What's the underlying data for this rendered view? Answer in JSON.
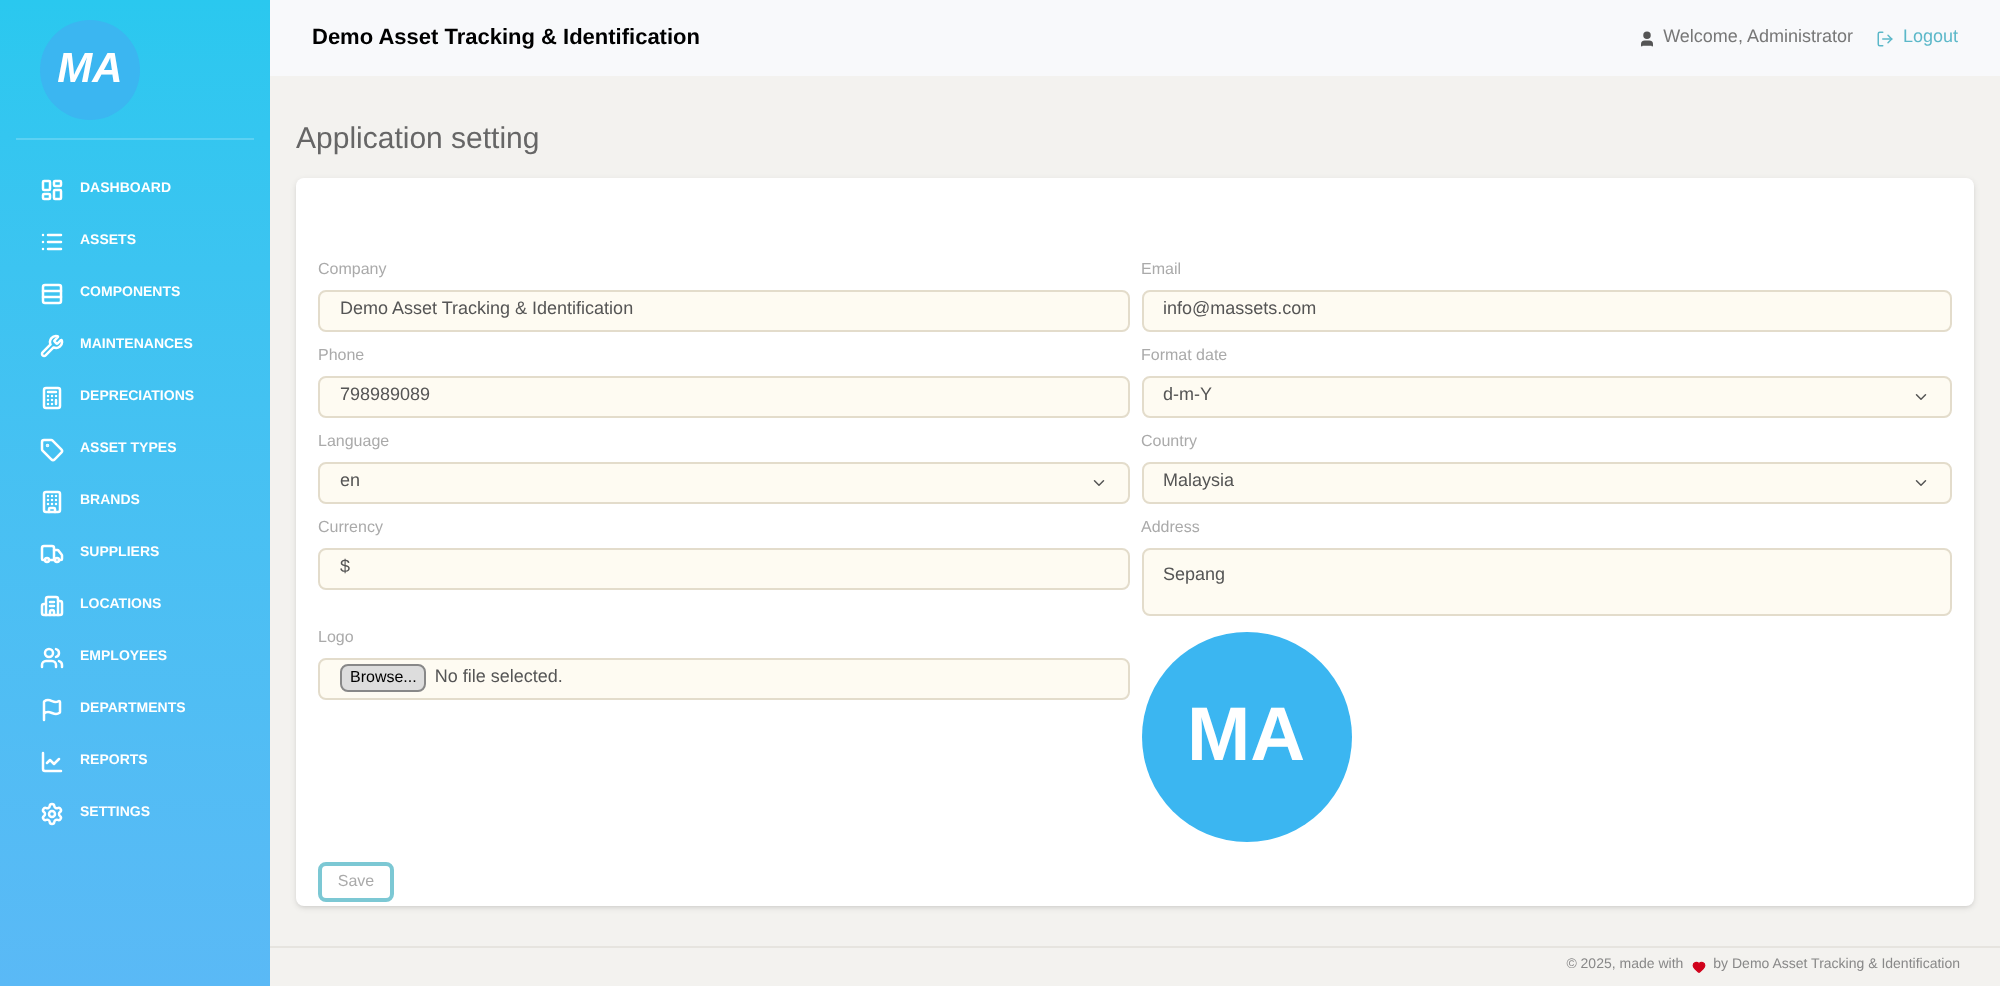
{
  "sidebar": {
    "logo": "MA",
    "items": [
      {
        "label": "DASHBOARD"
      },
      {
        "label": "ASSETS"
      },
      {
        "label": "COMPONENTS"
      },
      {
        "label": "MAINTENANCES"
      },
      {
        "label": "DEPRECIATIONS"
      },
      {
        "label": "ASSET TYPES"
      },
      {
        "label": "BRANDS"
      },
      {
        "label": "SUPPLIERS"
      },
      {
        "label": "LOCATIONS"
      },
      {
        "label": "EMPLOYEES"
      },
      {
        "label": "DEPARTMENTS"
      },
      {
        "label": "REPORTS"
      },
      {
        "label": "SETTINGS"
      }
    ]
  },
  "header": {
    "title": "Demo Asset Tracking & Identification",
    "welcome": "Welcome, Administrator",
    "logout": "Logout"
  },
  "page": {
    "title": "Application setting"
  },
  "form": {
    "left": [
      {
        "label": "Company",
        "kind": "text",
        "value": "Demo Asset Tracking & Identification"
      },
      {
        "label": "Phone",
        "kind": "text",
        "value": "798989089"
      },
      {
        "label": "Language",
        "kind": "select",
        "value": "en"
      },
      {
        "label": "Currency",
        "kind": "text",
        "value": "$"
      },
      {
        "label": "Logo",
        "kind": "file",
        "button": "Browse...",
        "value": "No file selected."
      }
    ],
    "right": [
      {
        "label": "Email",
        "kind": "text",
        "value": "info@massets.com"
      },
      {
        "label": "Format date",
        "kind": "select",
        "value": "d-m-Y"
      },
      {
        "label": "Country",
        "kind": "select",
        "value": "Malaysia"
      },
      {
        "label": "Address",
        "kind": "textarea",
        "value": "Sepang"
      }
    ],
    "logo_preview": "MA",
    "save": "Save"
  },
  "footer": {
    "prefix": "© 2025, made with",
    "suffix": "by Demo Asset Tracking & Identification"
  }
}
